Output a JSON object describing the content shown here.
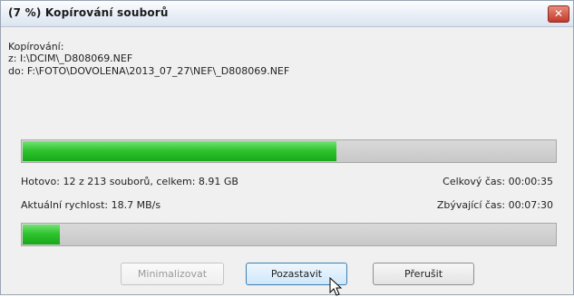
{
  "window": {
    "title": "(7 %) Kopírování souborů",
    "close_glyph": "✕"
  },
  "info": {
    "label": "Kopírování:",
    "from": "z: I:\\DCIM\\_D808069.NEF",
    "to": "do: F:\\FOTO\\DOVOLENA\\2013_07_27\\NEF\\_D808069.NEF"
  },
  "file_progress": {
    "fraction": 0.59
  },
  "stats": {
    "done": "Hotovo: 12 z 213 souborů, celkem: 8.91 GB",
    "total_time": "Celkový čas: 00:00:35",
    "speed": "Aktuální rychlost: 18.7 MB/s",
    "remaining": "Zbývající čas: 00:07:30"
  },
  "total_progress": {
    "fraction": 0.07
  },
  "buttons": {
    "minimize": "Minimalizovat",
    "pause": "Pozastavit",
    "abort": "Přerušit"
  },
  "colors": {
    "progress_green": "#2fc42f",
    "close_red": "#c2382a"
  },
  "icons": {
    "close": "close-icon",
    "cursor": "mouse-pointer-icon"
  }
}
